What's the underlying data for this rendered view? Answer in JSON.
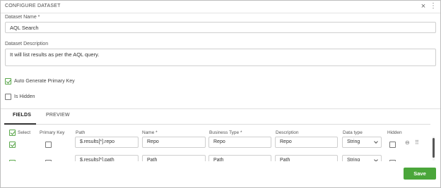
{
  "dialog": {
    "title": "CONFIGURE DATASET",
    "close_glyph": "×",
    "more_glyph": "⋮"
  },
  "form": {
    "name_label": "Dataset Name *",
    "name_value": "AQL Search",
    "description_label": "Dataset Description",
    "description_value": "It will list results as per the AQL query.",
    "auto_pk_label": "Auto Generate Primary Key",
    "auto_pk_checked": true,
    "hidden_label": "Is Hidden",
    "hidden_checked": false
  },
  "tabs": [
    {
      "label": "FIELDS",
      "active": true
    },
    {
      "label": "PREVIEW",
      "active": false
    }
  ],
  "grid": {
    "columns": [
      "Select",
      "Primary Key",
      "Path",
      "Name *",
      "Business Type *",
      "Description",
      "Data type",
      "Hidden"
    ],
    "rows": [
      {
        "select": true,
        "primary_key": false,
        "path": "$.results[*].repo",
        "name": "Repo",
        "business_type": "Repo",
        "description": "Repo",
        "data_type": "String",
        "hidden": false
      },
      {
        "select": true,
        "primary_key": false,
        "path": "$.results[*].path",
        "name": "Path",
        "business_type": "Path",
        "description": "Path",
        "data_type": "String",
        "hidden": false
      }
    ]
  },
  "footer": {
    "save_label": "Save"
  },
  "colors": {
    "accent": "#4aa63a"
  },
  "icons": [
    "close-icon",
    "more-vertical-icon",
    "checkbox-icon",
    "chevron-down-icon",
    "remove-circle-icon",
    "drag-handle-icon"
  ]
}
